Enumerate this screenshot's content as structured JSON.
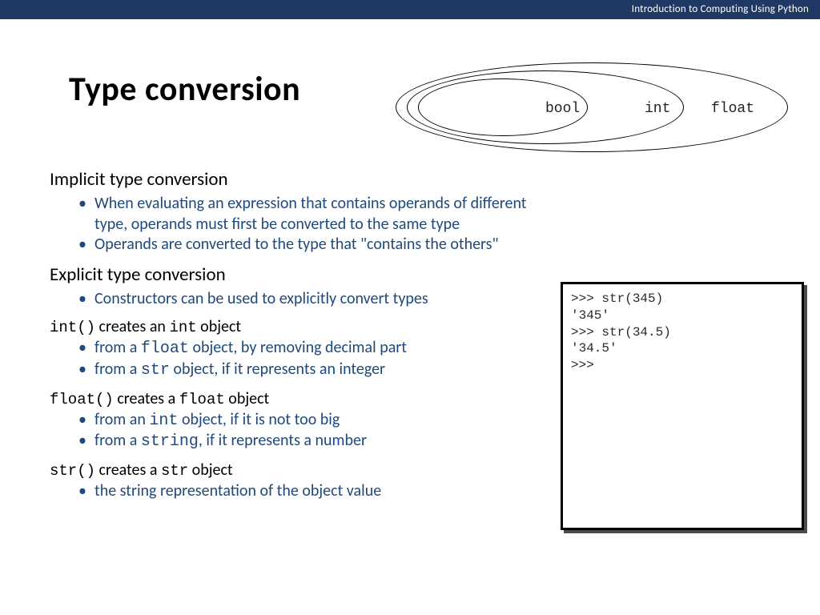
{
  "header": {
    "title": "Introduction to Computing Using Python"
  },
  "slide": {
    "title": "Type conversion",
    "diagram": {
      "inner": "bool",
      "middle": "int",
      "outer": "float"
    },
    "implicit": {
      "heading": "Implicit type conversion",
      "b1": "When evaluating an expression that contains operands of different type, operands must first be converted to the same type",
      "b2": "Operands are converted to the type that \"contains the others\""
    },
    "explicit": {
      "heading": "Explicit type conversion",
      "b1": "Constructors can be used to explicitly convert types"
    },
    "int_ctor": {
      "code": "int()",
      "mid": " creates an ",
      "obj": "int",
      "tail": " object",
      "b1a": "from a ",
      "b1m": "float",
      "b1b": " object, by removing decimal part",
      "b2a": "from a ",
      "b2m": "str",
      "b2b": " object, if it represents an integer"
    },
    "float_ctor": {
      "code": "float()",
      "mid": " creates a ",
      "obj": "float",
      "tail": " object",
      "b1a": "from an ",
      "b1m": "int",
      "b1b": " object, if it is not too big",
      "b2a": "from a ",
      "b2m": "string",
      "b2b": ", if it represents a number"
    },
    "str_ctor": {
      "code": "str()",
      "mid": " creates a ",
      "obj": "str",
      "tail": " object",
      "b1": "the string representation of the object value"
    },
    "code_box": ">>> str(345)\n'345'\n>>> str(34.5)\n'34.5'\n>>>"
  }
}
